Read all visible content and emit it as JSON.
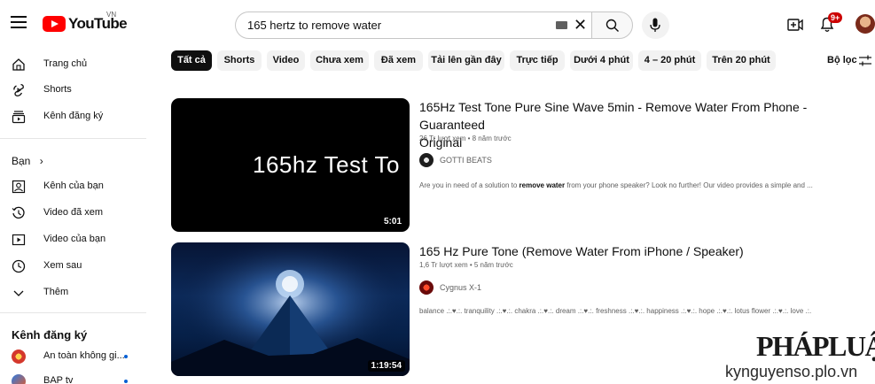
{
  "header": {
    "logo_text": "YouTube",
    "country_code": "VN",
    "search_value": "165 hertz to remove water",
    "notification_count": "9+"
  },
  "sidebar": {
    "main_items": [
      {
        "label": "Trang chủ",
        "icon": "home-icon"
      },
      {
        "label": "Shorts",
        "icon": "shorts-icon"
      },
      {
        "label": "Kênh đăng ký",
        "icon": "subscriptions-icon"
      }
    ],
    "you_heading": "Bạn",
    "you_items": [
      {
        "label": "Kênh của bạn",
        "icon": "your-channel-icon"
      },
      {
        "label": "Video đã xem",
        "icon": "history-icon"
      },
      {
        "label": "Video của bạn",
        "icon": "your-videos-icon"
      },
      {
        "label": "Xem sau",
        "icon": "watch-later-icon"
      },
      {
        "label": "Thêm",
        "icon": "chevron-down-icon"
      }
    ],
    "subs_heading": "Kênh đăng ký",
    "subscriptions": [
      {
        "label": "An toàn không gi..."
      },
      {
        "label": "BAP tv"
      }
    ]
  },
  "chips": [
    {
      "label": "Tất cả",
      "active": true
    },
    {
      "label": "Shorts"
    },
    {
      "label": "Video"
    },
    {
      "label": "Chưa xem"
    },
    {
      "label": "Đã xem"
    },
    {
      "label": "Tải lên gần đây"
    },
    {
      "label": "Trực tiếp"
    },
    {
      "label": "Dưới 4 phút"
    },
    {
      "label": "4 – 20 phút"
    },
    {
      "label": "Trên 20 phút"
    }
  ],
  "filter_label": "Bộ lọc",
  "results": [
    {
      "title_line1": "165Hz Test Tone Pure Sine Wave 5min - Remove Water From Phone - Guaranteed",
      "title_line2": "Original",
      "meta": "26 Tr lượt xem • 8 năm trước",
      "channel": "GOTTI BEATS",
      "desc_before": "Are you in need of a solution to ",
      "desc_bold": "remove water",
      "desc_after": " from your phone speaker? Look no further! Our video provides a simple and ...",
      "thumb_text": "165hz Test To",
      "duration": "5:01"
    },
    {
      "title_line1": "165 Hz Pure Tone (Remove Water From iPhone / Speaker)",
      "meta": "1,6 Tr lượt xem • 5 năm trước",
      "channel": "Cygnus X-1",
      "desc": "balance .:.♥.:. tranquility .:.♥.:. chakra .:.♥.:. dream .:.♥.:. freshness .:.♥.:. happiness .:.♥.:. hope .:.♥.:. lotus flower .:.♥.:. love .:.",
      "duration": "1:19:54"
    }
  ],
  "watermark": {
    "logo": "PHÁPLUẬT",
    "site": "kynguyenso.plo.vn"
  },
  "colors": {
    "brand_red": "#ff0000",
    "chip_active": "#0f0f0f",
    "chip_bg": "#f2f2f2",
    "badge": "#cc0000"
  }
}
